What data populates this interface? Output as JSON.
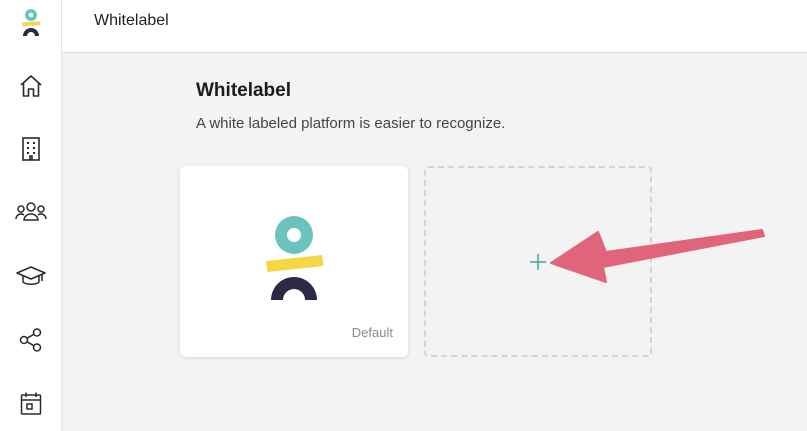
{
  "app": {
    "logo_icon": "brand-logo-icon",
    "brand_colors": {
      "teal": "#6cc3bd",
      "yellow": "#f6d645",
      "navy": "#2b2a45"
    }
  },
  "sidebar": {
    "items": [
      {
        "name": "home",
        "icon": "home-icon"
      },
      {
        "name": "buildings",
        "icon": "building-icon"
      },
      {
        "name": "people",
        "icon": "people-icon"
      },
      {
        "name": "education",
        "icon": "graduation-cap-icon"
      },
      {
        "name": "share",
        "icon": "share-icon"
      },
      {
        "name": "calendar",
        "icon": "calendar-icon"
      }
    ]
  },
  "header": {
    "title": "Whitelabel"
  },
  "main": {
    "title": "Whitelabel",
    "subtitle": "A white labeled platform is easier to recognize.",
    "cards": [
      {
        "label": "Default",
        "icon": "brand-logo-icon"
      }
    ],
    "add_card": {
      "icon": "plus-icon",
      "accent": "#4fb3ac"
    }
  },
  "annotation": {
    "icon": "pointer-arrow-icon",
    "color": "#e0647a"
  }
}
